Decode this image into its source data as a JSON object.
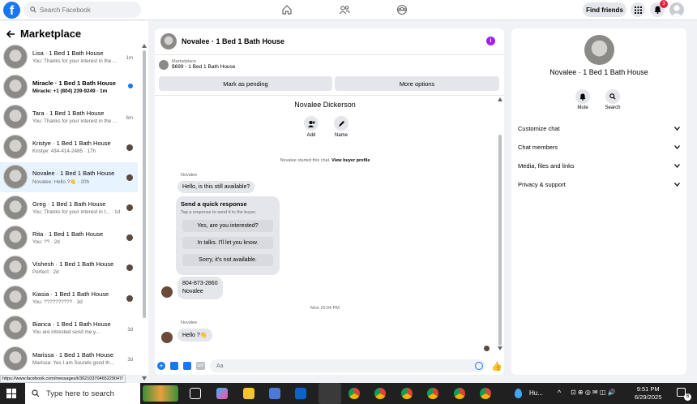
{
  "topbar": {
    "logo": "f",
    "search_placeholder": "Search Facebook",
    "find_friends": "Find friends",
    "notification_count": "3"
  },
  "marketplace": {
    "title": "Marketplace",
    "conversations": [
      {
        "name": "Lisa · 1 Bed 1 Bath House",
        "preview": "You: Thanks for your interest in the ...",
        "time": "1m",
        "unread": false,
        "active": false
      },
      {
        "name": "Miracle · 1 Bed 1 Bath House",
        "preview": "Miracle: +1 (804) 239-9249 · 1m",
        "time": "",
        "unread": true,
        "active": false
      },
      {
        "name": "Tara · 1 Bed 1 Bath House",
        "preview": "You: Thanks for your interest in the ...",
        "time": "6m",
        "unread": false,
        "active": false
      },
      {
        "name": "Kristye · 1 Bed 1 Bath House",
        "preview": "Kristye: 434-414-2485 · 17h",
        "time": "",
        "unread": false,
        "active": false
      },
      {
        "name": "Novalee · 1 Bed 1 Bath House",
        "preview": "Novalee: Hello ?👋 · 20h",
        "time": "",
        "unread": false,
        "active": true
      },
      {
        "name": "Greg · 1 Bed 1 Bath House",
        "preview": "You: Thanks for your interest in t... · 1d",
        "time": "",
        "unread": false,
        "active": false
      },
      {
        "name": "Rita · 1 Bed 1 Bath House",
        "preview": "You: ?? · 2d",
        "time": "",
        "unread": false,
        "active": false
      },
      {
        "name": "Vishesh · 1 Bed 1 Bath House",
        "preview": "Perfect · 2d",
        "time": "",
        "unread": false,
        "active": false
      },
      {
        "name": "Kiasia · 1 Bed 1 Bath House",
        "preview": "You: ?????????? · 3d",
        "time": "",
        "unread": false,
        "active": false
      },
      {
        "name": "Bianca · 1 Bed 1 Bath House",
        "preview": "You are intrested send me y...",
        "time": "3d",
        "unread": false,
        "active": false
      },
      {
        "name": "Marissa · 1 Bed 1 Bath House",
        "preview": "Marissa: Yes I am Sounds good th...",
        "time": "3d",
        "unread": false,
        "active": false
      }
    ]
  },
  "chat": {
    "header_name": "Novalee · 1 Bed 1 Bath House",
    "listing_label": "Marketplace",
    "listing_title": "$699 - 1 Bed 1 Bath House",
    "mark_pending": "Mark as pending",
    "more_options": "More options",
    "person_name": "Novalee Dickerson",
    "add_label": "Add",
    "name_label": "Name",
    "started_text": "Novalee started this chat.",
    "view_profile": "View buyer profile",
    "sender": "Novalee",
    "msg1": "Hello, is this still available?",
    "quick_title": "Send a quick response",
    "quick_sub": "Tap a response to send it to the buyer.",
    "quick_options": [
      "Yes, are you interested?",
      "In talks. I'll let you know.",
      "Sorry, it's not available."
    ],
    "msg2_line1": "804-873-2860",
    "msg2_line2": "Novalee",
    "timestamp": "Mon 10:04 PM",
    "sender2": "Novalee",
    "msg3": "Hello ?👋",
    "composer_placeholder": "Aa"
  },
  "right": {
    "name": "Novalee · 1 Bed 1 Bath House",
    "mute": "Mute",
    "search": "Search",
    "rows": [
      "Customize chat",
      "Chat members",
      "Media, files and links",
      "Privacy & support"
    ]
  },
  "status_url": "https://www.facebook.com/messages/t/30210370465229047/",
  "taskbar": {
    "search_placeholder": "Type here to search",
    "app_label": "Hu...",
    "time": "9:51 PM",
    "date": "6/29/2025",
    "notif_count": "6"
  }
}
